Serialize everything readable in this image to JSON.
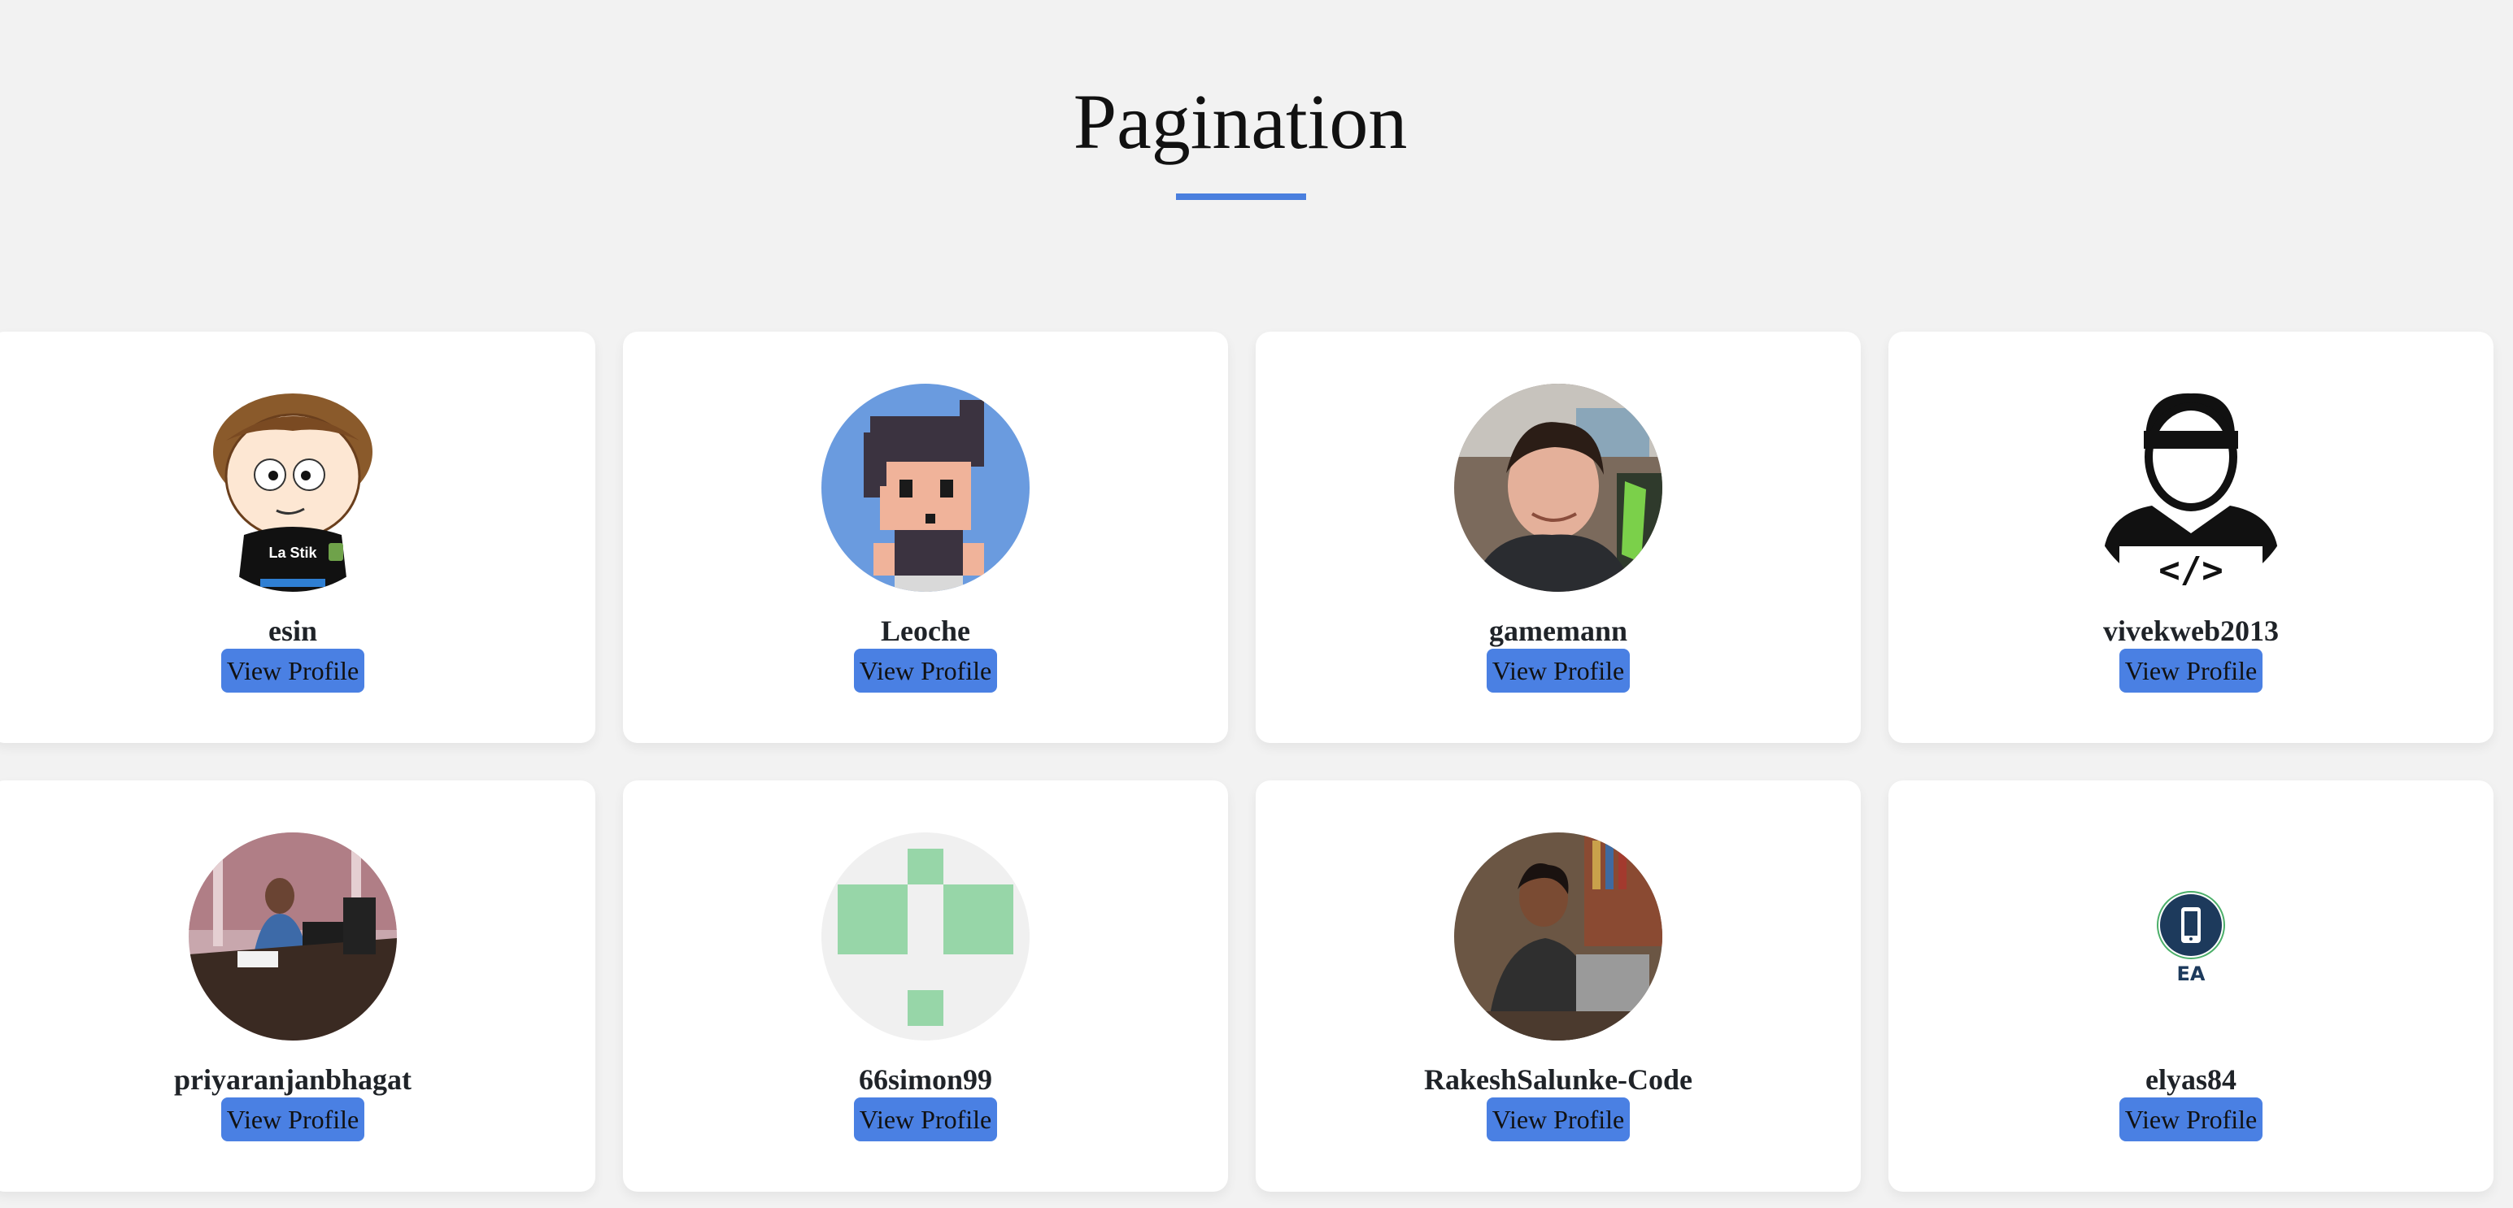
{
  "page": {
    "title": "Pagination",
    "accent_color": "#4a7fde"
  },
  "profiles": [
    {
      "username": "esin",
      "button_label": "View Profile",
      "avatar": "cartoon-avatar-icon"
    },
    {
      "username": "Leoche",
      "button_label": "View Profile",
      "avatar": "pixel-character-avatar-icon"
    },
    {
      "username": "gamemann",
      "button_label": "View Profile",
      "avatar": "user-photo-avatar"
    },
    {
      "username": "vivekweb2013",
      "button_label": "View Profile",
      "avatar": "developer-silhouette-icon"
    },
    {
      "username": "priyaranjanbhagat",
      "button_label": "View Profile",
      "avatar": "office-photo-avatar"
    },
    {
      "username": "66simon99",
      "button_label": "View Profile",
      "avatar": "identicon-avatar"
    },
    {
      "username": "RakeshSalunke-Code",
      "button_label": "View Profile",
      "avatar": "laptop-photo-avatar"
    },
    {
      "username": "elyas84",
      "button_label": "View Profile",
      "avatar": "phone-logo-avatar"
    }
  ],
  "avatar_logo_text": "EA",
  "avatar_shirt_text": "La Stik"
}
